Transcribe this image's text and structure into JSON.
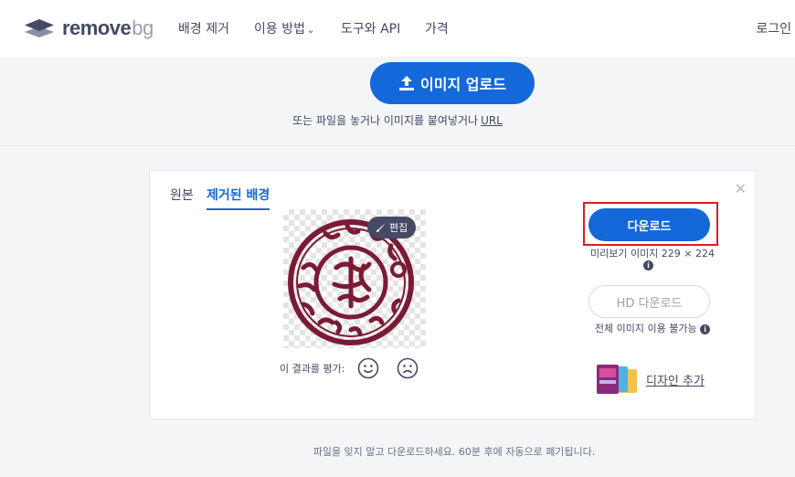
{
  "header": {
    "logo": {
      "word1": "remove",
      "word2": "bg"
    },
    "nav": {
      "remove_bg": "배경 제거",
      "how_to_use": "이용 방법",
      "tools_api": "도구와 API",
      "pricing": "가격"
    },
    "login": "로그인"
  },
  "upload": {
    "button_label": "이미지 업로드",
    "hint_text": "또는 파일을 놓거나 이미지를 붙여넣거나",
    "url_link": "URL"
  },
  "result": {
    "tabs": {
      "original": "원본",
      "removed": "제거된 배경"
    },
    "edit_label": "편집",
    "rate_label": "이 결과를 평가:",
    "download_label": "다운로드",
    "preview_size_text": "미리보기 이미지 229 × 224",
    "hd_download_label": "HD 다운로드",
    "full_image_text": "전체 이미지 이용 불가능",
    "add_design_label": "디자인 추가"
  },
  "footer": {
    "note": "파일을 잊지 말고 다운로드하세요. 60분 후에 자동으로 폐기됩니다."
  },
  "colors": {
    "accent": "#1468d9",
    "text": "#454964",
    "highlight_box": "#e01c1c",
    "stamp": "#7a1b35"
  },
  "icons": [
    "logo-layers-icon",
    "chevron-down-icon",
    "upload-icon",
    "close-icon",
    "brush-icon",
    "smile-icon",
    "frown-icon",
    "info-icon"
  ]
}
